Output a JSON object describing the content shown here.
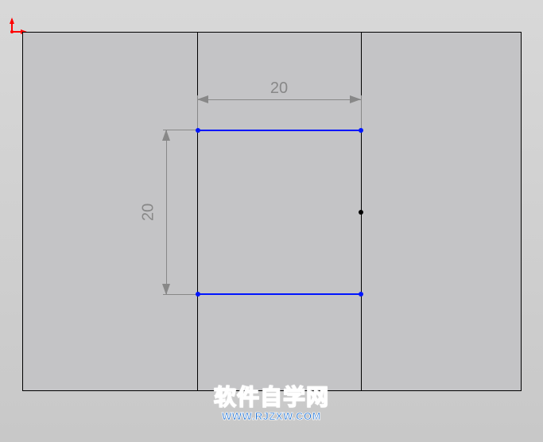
{
  "origin": {
    "x_axis_color": "#ff0000",
    "y_axis_color": "#00a000"
  },
  "dimensions": {
    "horizontal": "20",
    "vertical": "20"
  },
  "sketch": {
    "line_color": "#0015ff",
    "outer_width": 628,
    "outer_height": 452
  },
  "watermark": {
    "title": "软件自学网",
    "url": "WWW.RJZXW.COM"
  }
}
